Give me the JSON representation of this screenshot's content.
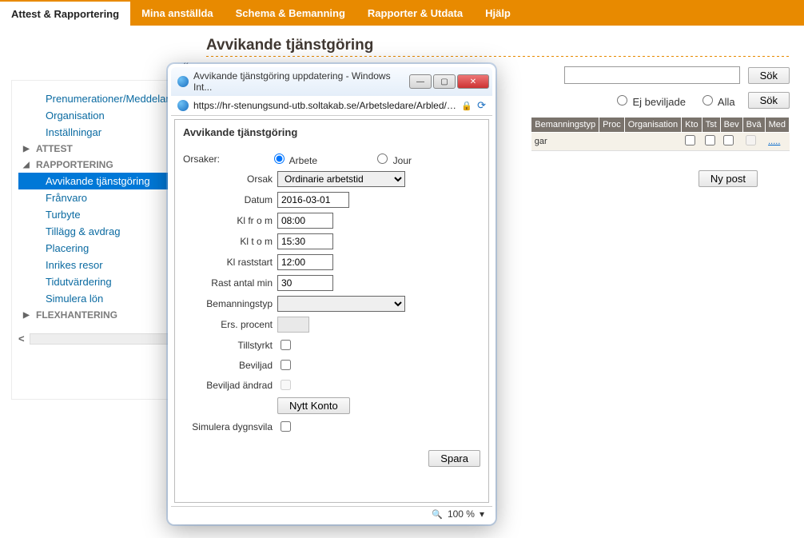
{
  "topnav": {
    "tabs": [
      {
        "label": "Attest & Rapportering",
        "active": true
      },
      {
        "label": "Mina anställda"
      },
      {
        "label": "Schema & Bemanning"
      },
      {
        "label": "Rapporter & Utdata"
      },
      {
        "label": "Hjälp"
      }
    ]
  },
  "sidebar": {
    "links_top": [
      "Prenumerationer/Meddelan",
      "Organisation",
      "Inställningar"
    ],
    "sections": [
      {
        "title": "ATTEST",
        "open": false,
        "items": []
      },
      {
        "title": "RAPPORTERING",
        "open": true,
        "items": [
          "Avvikande tjänstgöring",
          "Frånvaro",
          "Turbyte",
          "Tillägg & avdrag",
          "Placering",
          "Inrikes resor",
          "Tidutvärdering",
          "Simulera lön"
        ],
        "selected": "Avvikande tjänstgöring"
      },
      {
        "title": "FLEXHANTERING",
        "open": false,
        "items": []
      }
    ]
  },
  "page": {
    "title": "Avvikande tjänstgöring",
    "search_btn": "Sök",
    "filter": {
      "opt_ej": "Ej beviljade",
      "opt_alla": "Alla",
      "sok": "Sök"
    },
    "table": {
      "cols": [
        "Bemanningstyp",
        "Proc",
        "Organisation",
        "Kto",
        "Tst",
        "Bev",
        "Bvä",
        "Med"
      ],
      "row_suffix": "gar",
      "med_link": "....."
    },
    "nypost": "Ny post"
  },
  "modal": {
    "window_title": "Avvikande tjänstgöring uppdatering - Windows Int...",
    "url": "https://hr-stenungsund-utb.soltakab.se/Arbetsledare/Arbled/Au",
    "section_title": "Avvikande tjänstgöring",
    "orsaker_label": "Orsaker:",
    "radio_arbete": "Arbete",
    "radio_jour": "Jour",
    "fields": {
      "orsak_label": "Orsak",
      "orsak_value": "Ordinarie arbetstid",
      "datum_label": "Datum",
      "datum_value": "2016-03-01",
      "klfrom_label": "Kl fr o m",
      "klfrom_value": "08:00",
      "kltom_label": "Kl t o m",
      "kltom_value": "15:30",
      "raststart_label": "Kl raststart",
      "raststart_value": "12:00",
      "rastmin_label": "Rast antal min",
      "rastmin_value": "30",
      "bemtyp_label": "Bemanningstyp",
      "ersproc_label": "Ers. procent",
      "tillstyrkt_label": "Tillstyrkt",
      "beviljad_label": "Beviljad",
      "bevandrad_label": "Beviljad ändrad",
      "nyttkonto_btn": "Nytt Konto",
      "simdygn_label": "Simulera dygnsvila",
      "spara_btn": "Spara"
    },
    "zoom": "100 %"
  }
}
